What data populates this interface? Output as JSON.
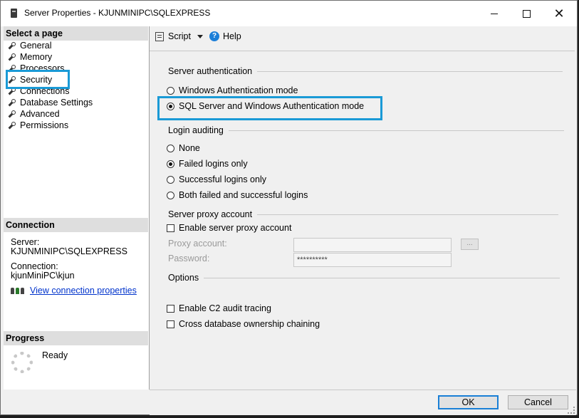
{
  "window": {
    "title": "Server Properties - KJUNMINIPC\\SQLEXPRESS",
    "minimize_glyph": "",
    "maximize_glyph": "",
    "close_glyph": "✕"
  },
  "left": {
    "select_page_title": "Select a page",
    "pages": [
      "General",
      "Memory",
      "Processors",
      "Security",
      "Connections",
      "Database Settings",
      "Advanced",
      "Permissions"
    ],
    "selected_page": "Security",
    "connection_title": "Connection",
    "server_label": "Server:",
    "server_value": "KJUNMINIPC\\SQLEXPRESS",
    "connection_label": "Connection:",
    "connection_value": "kjunMiniPC\\kjun",
    "view_connection_link": "View connection properties",
    "progress_title": "Progress",
    "progress_status": "Ready"
  },
  "toolbar": {
    "script_label": "Script",
    "help_label": "Help",
    "help_glyph": "?"
  },
  "security": {
    "server_auth_title": "Server authentication",
    "auth_windows": "Windows Authentication mode",
    "auth_mixed": "SQL Server and Windows Authentication mode",
    "auth_selected": "mixed",
    "login_auditing_title": "Login auditing",
    "audit_none": "None",
    "audit_failed": "Failed logins only",
    "audit_successful": "Successful logins only",
    "audit_both": "Both failed and successful logins",
    "audit_selected": "failed",
    "proxy_title": "Server proxy account",
    "enable_proxy": "Enable server proxy account",
    "enable_proxy_checked": false,
    "proxy_account_label": "Proxy account:",
    "proxy_account_value": "",
    "password_label": "Password:",
    "password_value": "**********",
    "browse_label": "...",
    "options_title": "Options",
    "c2_audit": "Enable C2 audit tracing",
    "c2_checked": false,
    "cross_db": "Cross database ownership chaining",
    "cross_db_checked": false
  },
  "footer": {
    "ok_label": "OK",
    "cancel_label": "Cancel"
  },
  "colors": {
    "highlight": "#1a9ad6",
    "link": "#0033cc",
    "help_icon": "#1c7fd8"
  }
}
